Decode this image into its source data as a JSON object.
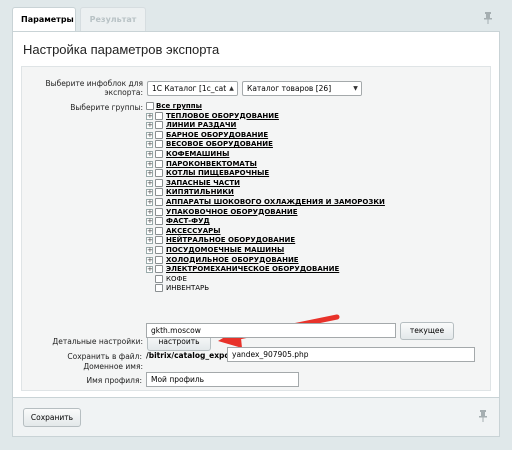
{
  "tabs": {
    "active": "Параметры",
    "inactive": "Результат"
  },
  "title": "Настройка параметров экспорта",
  "iblock": {
    "label_line1": "Выберите инфоблок для",
    "label_line2": "экспорта:",
    "type_value": "1С Каталог [1c_cata",
    "iblock_value": "Каталог товаров [26]"
  },
  "groups": {
    "label": "Выберите группы:",
    "all": "Все группы",
    "items": [
      {
        "text": "ТЕПЛОВОЕ ОБОРУДОВАНИЕ",
        "expandable": true
      },
      {
        "text": "ЛИНИИ РАЗДАЧИ",
        "expandable": true
      },
      {
        "text": "БАРНОЕ ОБОРУДОВАНИЕ",
        "expandable": true
      },
      {
        "text": "ВЕСОВОЕ ОБОРУДОВАНИЕ",
        "expandable": true
      },
      {
        "text": "КОФЕМАШИНЫ",
        "expandable": true
      },
      {
        "text": "ПАРОКОНВЕКТОМАТЫ",
        "expandable": true
      },
      {
        "text": "КОТЛЫ ПИЩЕВАРОЧНЫЕ",
        "expandable": true
      },
      {
        "text": "ЗАПАСНЫЕ ЧАСТИ",
        "expandable": true
      },
      {
        "text": "КИПЯТИЛЬНИКИ",
        "expandable": true
      },
      {
        "text": "АППАРАТЫ ШОКОВОГО ОХЛАЖДЕНИЯ И ЗАМОРОЗКИ",
        "expandable": true
      },
      {
        "text": "УПАКОВОЧНОЕ ОБОРУДОВАНИЕ",
        "expandable": true
      },
      {
        "text": "ФАСТ-ФУД",
        "expandable": true
      },
      {
        "text": "АКСЕССУАРЫ",
        "expandable": true
      },
      {
        "text": "НЕЙТРАЛЬНОЕ ОБОРУДОВАНИЕ",
        "expandable": true
      },
      {
        "text": "ПОСУДОМОЕЧНЫЕ МАШИНЫ",
        "expandable": true
      },
      {
        "text": "ХОЛОДИЛЬНОЕ ОБОРУДОВАНИЕ",
        "expandable": true
      },
      {
        "text": "ЭЛЕКТРОМЕХАНИЧЕСКОЕ ОБОРУДОВАНИЕ",
        "expandable": true
      },
      {
        "text": "КОФЕ",
        "expandable": false
      },
      {
        "text": "ИНВЕНТАРЬ",
        "expandable": false
      }
    ]
  },
  "detail": {
    "label": "Детальные настройки:",
    "button": "настроить"
  },
  "domain": {
    "label": "Доменное имя:",
    "value": "gkth.moscow",
    "button": "текущее"
  },
  "file": {
    "label": "Сохранить в файл:",
    "prefix": "/bitrix/catalog_export/",
    "value": "yandex_907905.php"
  },
  "profile": {
    "label": "Имя профиля:",
    "value": "Мой профиль"
  },
  "footer": {
    "save_button": "Сохранить"
  },
  "colors": {
    "arrow": "#e8322a",
    "background": "#e0e8ea"
  },
  "icons": {
    "pin": "pin-icon",
    "arrow": "red-arrow-annotation"
  }
}
